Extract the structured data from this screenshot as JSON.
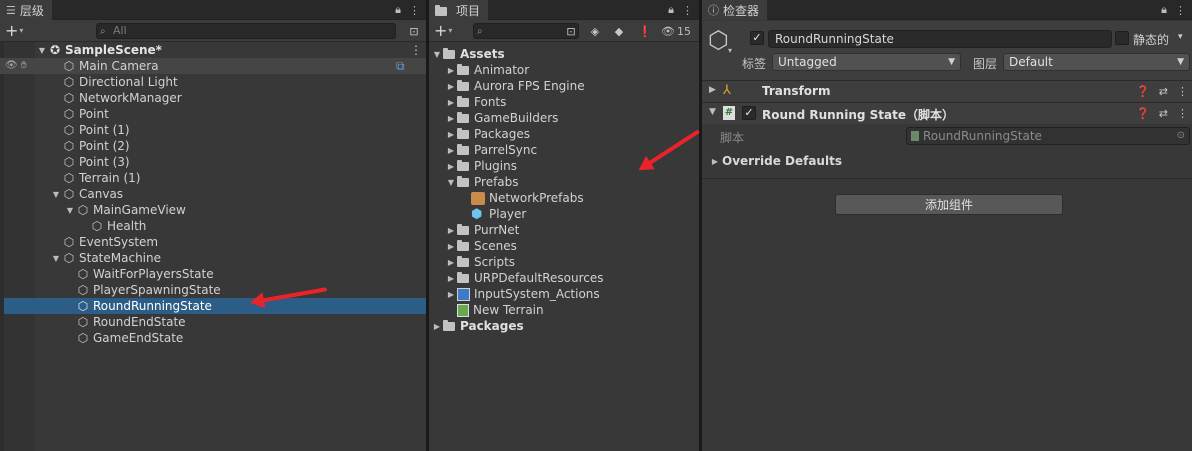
{
  "hierarchy": {
    "tab": "层级",
    "search_placeholder": "All",
    "scene": "SampleScene*",
    "items": [
      {
        "label": "Main Camera"
      },
      {
        "label": "Directional Light"
      },
      {
        "label": "NetworkManager"
      },
      {
        "label": "Point"
      },
      {
        "label": "Point (1)"
      },
      {
        "label": "Point (2)"
      },
      {
        "label": "Point (3)"
      },
      {
        "label": "Terrain (1)"
      },
      {
        "label": "Canvas"
      },
      {
        "label": "MainGameView"
      },
      {
        "label": "Health"
      },
      {
        "label": "EventSystem"
      },
      {
        "label": "StateMachine"
      },
      {
        "label": "WaitForPlayersState"
      },
      {
        "label": "PlayerSpawningState"
      },
      {
        "label": "RoundRunningState"
      },
      {
        "label": "RoundEndState"
      },
      {
        "label": "GameEndState"
      }
    ]
  },
  "project": {
    "tab": "项目",
    "hidden_count": "15",
    "items": [
      {
        "label": "Assets"
      },
      {
        "label": "Animator"
      },
      {
        "label": "Aurora FPS Engine"
      },
      {
        "label": "Fonts"
      },
      {
        "label": "GameBuilders"
      },
      {
        "label": "Packages"
      },
      {
        "label": "ParrelSync"
      },
      {
        "label": "Plugins"
      },
      {
        "label": "Prefabs"
      },
      {
        "label": "NetworkPrefabs"
      },
      {
        "label": "Player"
      },
      {
        "label": "PurrNet"
      },
      {
        "label": "Scenes"
      },
      {
        "label": "Scripts"
      },
      {
        "label": "URPDefaultResources"
      },
      {
        "label": "InputSystem_Actions"
      },
      {
        "label": "New Terrain"
      },
      {
        "label": "Packages"
      }
    ]
  },
  "inspector": {
    "tab": "检查器",
    "object_name": "RoundRunningState",
    "static_label": "静态的",
    "tag_label": "标签",
    "tag_value": "Untagged",
    "layer_label": "图层",
    "layer_value": "Default",
    "transform_title": "Transform",
    "component_title": "Round Running State（脚本）",
    "script_label": "脚本",
    "script_value": "RoundRunningState",
    "override_label": "Override Defaults",
    "add_component": "添加组件"
  },
  "colors": {
    "selection": "#2c5d87",
    "arrow": "#e8242a",
    "panel_bg": "#383838"
  }
}
